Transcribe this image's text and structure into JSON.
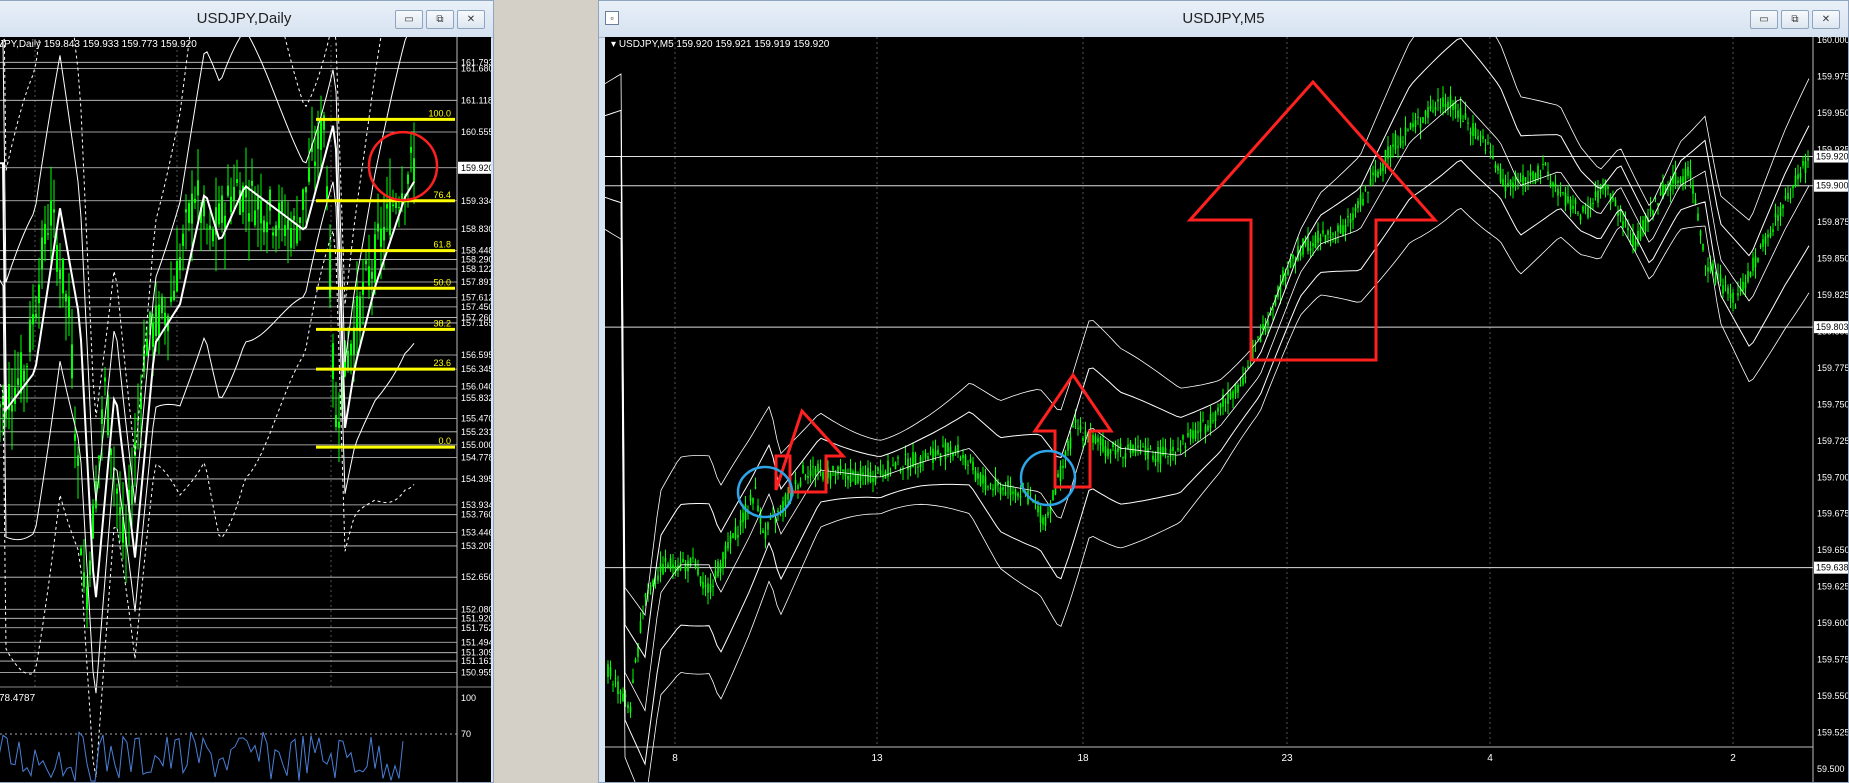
{
  "left_window": {
    "title": "USDJPY,Daily",
    "info": "JPY,Daily  159.843 159.933 159.773 159.920",
    "rsi_label": "78.4787",
    "rsi_levels": [
      "100",
      "70"
    ]
  },
  "right_window": {
    "title": "USDJPY,M5",
    "info": "USDJPY,M5  159.920 159.921 159.919 159.920"
  },
  "window_buttons": {
    "minimize": "▭",
    "restore": "⧉",
    "close": "✕"
  },
  "colors": {
    "bull_candle": "#00ff00",
    "fib": "#ffff00",
    "arrow": "#ff2020",
    "circle_red": "#ff2020",
    "circle_blue": "#2fa4e7",
    "band": "#ffffff"
  },
  "chart_data": [
    {
      "type": "candlestick",
      "symbol": "USDJPY",
      "timeframe": "Daily",
      "ohlc_last": {
        "open": 159.843,
        "high": 159.933,
        "low": 159.773,
        "close": 159.92
      },
      "price_labels": [
        {
          "value": "161.793",
          "y": 161.793
        },
        {
          "value": "161.680",
          "y": 161.68
        },
        {
          "value": "161.118",
          "y": 161.118
        },
        {
          "value": "160.555",
          "y": 160.555
        },
        {
          "value": "159.920",
          "y": 159.92
        },
        {
          "value": "159.334",
          "y": 159.334
        },
        {
          "value": "158.830",
          "y": 158.83
        },
        {
          "value": "158.448",
          "y": 158.448
        },
        {
          "value": "158.290",
          "y": 158.29
        },
        {
          "value": "158.122",
          "y": 158.122
        },
        {
          "value": "157.891",
          "y": 157.891
        },
        {
          "value": "157.612",
          "y": 157.612
        },
        {
          "value": "157.450",
          "y": 157.45
        },
        {
          "value": "157.260",
          "y": 157.26
        },
        {
          "value": "157.165",
          "y": 157.165
        },
        {
          "value": "156.595",
          "y": 156.595
        },
        {
          "value": "156.345",
          "y": 156.345
        },
        {
          "value": "156.040",
          "y": 156.04
        },
        {
          "value": "155.832",
          "y": 155.832
        },
        {
          "value": "155.470",
          "y": 155.47
        },
        {
          "value": "155.231",
          "y": 155.231
        },
        {
          "value": "155.000",
          "y": 155.0
        },
        {
          "value": "154.778",
          "y": 154.778
        },
        {
          "value": "154.395",
          "y": 154.395
        },
        {
          "value": "153.934",
          "y": 153.934
        },
        {
          "value": "153.760",
          "y": 153.76
        },
        {
          "value": "153.446",
          "y": 153.446
        },
        {
          "value": "153.205",
          "y": 153.205
        },
        {
          "value": "152.650",
          "y": 152.65
        },
        {
          "value": "152.080",
          "y": 152.08
        },
        {
          "value": "151.920",
          "y": 151.92
        },
        {
          "value": "151.752",
          "y": 151.752
        },
        {
          "value": "151.494",
          "y": 151.494
        },
        {
          "value": "151.309",
          "y": 151.309
        },
        {
          "value": "151.161",
          "y": 151.161
        },
        {
          "value": "150.955",
          "y": 150.955
        }
      ],
      "fibonacci": [
        {
          "label": "100.0",
          "price": 160.78
        },
        {
          "label": "76.4",
          "price": 159.334
        },
        {
          "label": "61.8",
          "price": 158.448
        },
        {
          "label": "50.0",
          "price": 157.78
        },
        {
          "label": "38.2",
          "price": 157.05
        },
        {
          "label": "23.6",
          "price": 156.345
        },
        {
          "label": "0.0",
          "price": 154.96
        }
      ],
      "ylim": [
        150.7,
        162.1
      ]
    },
    {
      "type": "candlestick",
      "symbol": "USDJPY",
      "timeframe": "M5",
      "ohlc_last": {
        "open": 159.92,
        "high": 159.921,
        "low": 159.919,
        "close": 159.92
      },
      "x_ticks": [
        "8",
        "13",
        "18",
        "23",
        "4",
        "2"
      ],
      "y_ticks": [
        "160.000",
        "159.975",
        "159.950",
        "159.925",
        "159.900",
        "159.875",
        "159.850",
        "159.825",
        "159.800",
        "159.775",
        "159.750",
        "159.725",
        "159.700",
        "159.675",
        "159.650",
        "159.625",
        "159.600",
        "159.575",
        "159.550",
        "159.525",
        "59.500"
      ],
      "marked_prices": [
        "159.920",
        "159.900",
        "159.803",
        "159.638"
      ],
      "ylim": [
        159.515,
        160.002
      ]
    }
  ]
}
